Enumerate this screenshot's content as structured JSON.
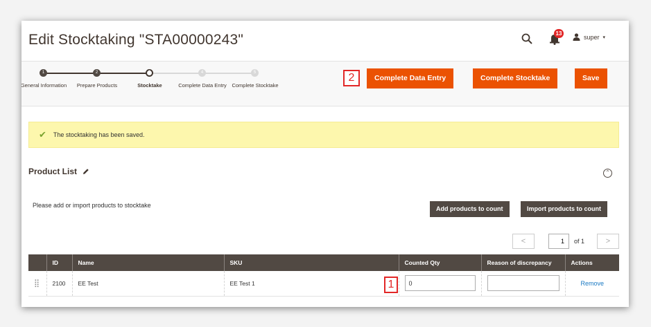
{
  "page": {
    "title": "Edit Stocktaking \"STA00000243\"",
    "notification_count": "13",
    "user": "super",
    "accent_color": "#eb5202"
  },
  "steps": [
    {
      "num": "1",
      "label": "General Information",
      "state": "done"
    },
    {
      "num": "2",
      "label": "Prepare Products",
      "state": "done"
    },
    {
      "num": "3",
      "label": "Stocktake",
      "state": "current"
    },
    {
      "num": "4",
      "label": "Complete Data Entry",
      "state": "future"
    },
    {
      "num": "5",
      "label": "Complete Stocktake",
      "state": "future"
    }
  ],
  "actions": {
    "complete_data_entry": "Complete Data Entry",
    "complete_stocktake": "Complete Stocktake",
    "save": "Save"
  },
  "markers": {
    "first": "1",
    "second": "2"
  },
  "message": "The stocktaking has been saved.",
  "product_list": {
    "title": "Product List",
    "hint": "Please add or import products to stocktake",
    "add_button": "Add products to count",
    "import_button": "Import products to count",
    "pager": {
      "prev": "<",
      "next": ">",
      "page": "1",
      "of_label": "of 1"
    },
    "columns": [
      "ID",
      "Name",
      "SKU",
      "Counted Qty",
      "Reason of discrepancy",
      "Actions"
    ],
    "rows": [
      {
        "id": "2100",
        "name": "EE Test",
        "sku": "EE Test 1",
        "counted_qty": "0",
        "reason": "",
        "action": "Remove"
      }
    ]
  }
}
